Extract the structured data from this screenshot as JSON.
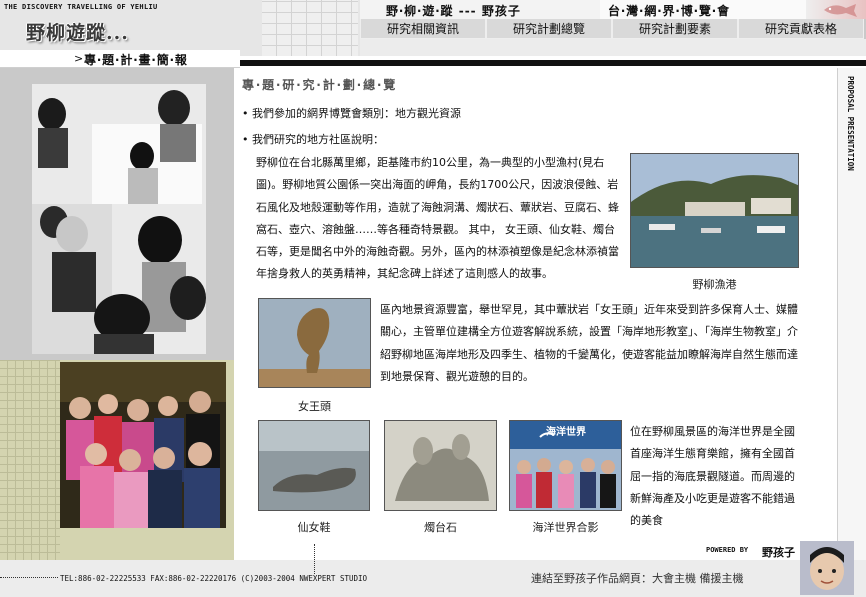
{
  "header": {
    "site_tag": "THE DISCOVERY TRAVELLING OF YEHLIU",
    "logo_text": "野柳遊蹤...",
    "topic_title": "野‧柳‧遊‧蹤 --- 野孩子",
    "expo_title": "台‧灣‧網‧界‧博‧覽‧會",
    "subtitle": "專‧題‧計‧畫‧簡‧報",
    "nav": [
      {
        "label": "研究相關資訊"
      },
      {
        "label": "研究計劃總覽"
      },
      {
        "label": "研究計劃要素"
      },
      {
        "label": "研究貢獻表格"
      }
    ]
  },
  "main": {
    "section_title": "專‧題‧研‧究‧計‧劃‧總‧覽",
    "bullet1": "•  我們參加的網界博覽會類別：地方觀光資源",
    "bullet2": "•  我們研究的地方社區說明：",
    "para1": "野柳位在台北縣萬里鄉，距基隆市約10公里，為一典型的小型漁村(見右圖)。野柳地質公園係一突出海面的岬角，長約1700公尺，因波浪侵蝕、岩石風化及地殼運動等作用，造就了海蝕洞溝、燭狀石、蕈狀岩、豆腐石、蜂窩石、壺穴、溶蝕盤……等各種奇特景觀。 其中， 女王頭、仙女鞋、燭台石等，更是聞名中外的海蝕奇觀。另外，區內的林添禎塑像是紀念林添禎當年捨身救人的英勇精神，其紀念碑上詳述了這則感人的故事。",
    "para2": "區內地景資源豐富，舉世罕見，其中蕈狀岩「女王頭」近年來受到許多保育人士、媒體關心，主管單位建構全方位遊客解說系統，設置「海岸地形教室」、「海岸生物教室」介紹野柳地區海岸地形及四季生、植物的千變萬化，使遊客能益加瞭解海岸自然生態而達到地景保育、觀光遊憩的目的。",
    "para3": "位在野柳風景區的海洋世界是全國首座海洋生態育樂館，擁有全國首屈一指的海底景觀隧道。而周邊的新鮮海產及小吃更是遊客不能錯過的美食",
    "captions": {
      "harbor": "野柳漁港",
      "queen": "女王頭",
      "fairy": "仙女鞋",
      "candle": "燭台石",
      "ocean": "海洋世界合影"
    },
    "ocean_sign": "海洋世界",
    "side_label": "PROPOSAL PRESENTATION"
  },
  "footer": {
    "powered_by": "POWERED BY",
    "powered_name": "野孩子",
    "contact": "TEL:886-02-22225533   FAX:886-02-22220176   (C)2003-2004 NWEXPERT STUDIO",
    "link_text": "連結至野孩子作品網頁：大會主機 備援主機"
  },
  "colors": {
    "header_bg": "#e6e6e6",
    "nav_bg": "#d9d9d9",
    "left_lower_bg": "#d4d4b0",
    "accent_black": "#111111"
  },
  "icons": [
    "fish-icon",
    "arrow-icon",
    "bullet-icon",
    "square-icon"
  ]
}
